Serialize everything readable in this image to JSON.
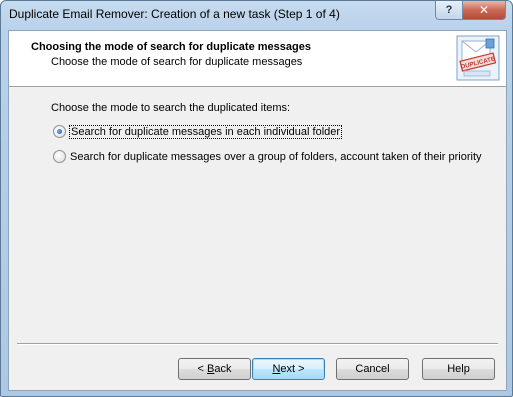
{
  "window": {
    "title": "Duplicate Email Remover: Creation of a new task (Step 1 of 4)",
    "help_glyph": "?",
    "close_glyph": "✕"
  },
  "header": {
    "title": "Choosing the mode of search for duplicate messages",
    "subtitle": "Choose the mode of search for duplicate messages",
    "icon": "duplicate-stamp-icon",
    "icon_text": "DUPLICATE"
  },
  "body": {
    "prompt": "Choose the mode to search the duplicated items:",
    "options": [
      {
        "label": "Search for duplicate messages in each individual folder",
        "selected": true
      },
      {
        "label": "Search for duplicate messages over a group of folders, account taken of their priority",
        "selected": false
      }
    ]
  },
  "buttons": {
    "back": {
      "prefix": "< ",
      "mnemonic": "B",
      "rest": "ack"
    },
    "next": {
      "mnemonic": "N",
      "rest": "ext >"
    },
    "cancel": "Cancel",
    "help": "Help"
  },
  "colors": {
    "title_bar": "#b9d1ea",
    "dialog_bg": "#f0f0f0",
    "header_bg": "#ffffff",
    "close_button": "#c96a55"
  }
}
